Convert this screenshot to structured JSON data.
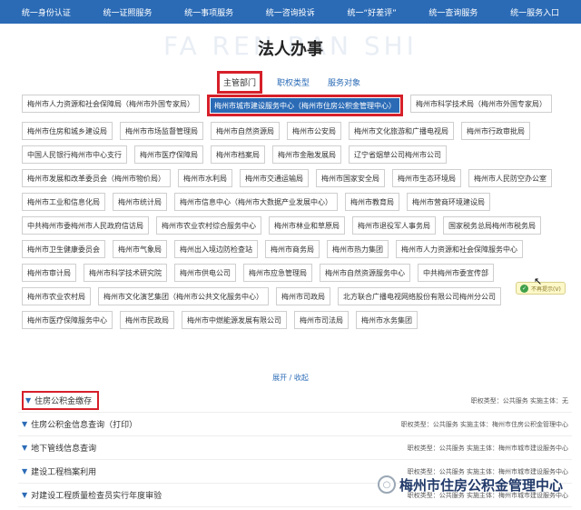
{
  "nav": {
    "items": [
      "统一身份认证",
      "统一证照服务",
      "统一事项服务",
      "统一咨询投诉",
      "统一“好差评”",
      "统一查询服务",
      "统一服务入口"
    ]
  },
  "hero": {
    "watermark": "FA REN BAN SHI",
    "title": "法人办事"
  },
  "tabs": {
    "items": [
      "主管部门",
      "职权类型",
      "服务对象"
    ],
    "active": 0
  },
  "departments": [
    "梅州市人力资源和社会保障局（梅州市外国专家局）",
    "梅州市城市建设服务中心（梅州市住房公积金管理中心）",
    "梅州市科学技术局（梅州市外国专家局）",
    "梅州市住房和城乡建设局",
    "梅州市市场监督管理局",
    "梅州市自然资源局",
    "梅州市公安局",
    "梅州市文化旅游和广播电视局",
    "梅州市行政审批局",
    "中国人民银行梅州市中心支行",
    "梅州市医疗保障局",
    "梅州市档案局",
    "梅州市金融发展局",
    "辽宁省烟草公司梅州市公司",
    "梅州市发展和改革委员会（梅州市物价局）",
    "梅州市水利局",
    "梅州市交通运输局",
    "梅州市国家安全局",
    "梅州市生态环境局",
    "梅州市人民防空办公室",
    "梅州市工业和信息化局",
    "梅州市统计局",
    "梅州市信息中心（梅州市大数据产业发展中心）",
    "梅州市教育局",
    "梅州市营商环境建设局",
    "中共梅州市委梅州市人民政府信访局",
    "梅州市农业农村综合服务中心",
    "梅州市林业和草原局",
    "梅州市退役军人事务局",
    "国家税务总局梅州市税务局",
    "梅州市卫生健康委员会",
    "梅州市气象局",
    "梅州出入境边防检查站",
    "梅州市商务局",
    "梅州市热力集团",
    "梅州市人力资源和社会保障服务中心",
    "梅州市审计局",
    "梅州市科学技术研究院",
    "梅州市供电公司",
    "梅州市应急管理局",
    "梅州市自然资源服务中心",
    "中共梅州市委宣传部",
    "梅州市农业农村局",
    "梅州市文化演艺集团（梅州市公共文化服务中心）",
    "梅州市司政局",
    "北方联合广播电视网络股份有限公司梅州分公司",
    "梅州市医疗保障服务中心",
    "梅州市民政局",
    "梅州市中燃能源发展有限公司",
    "梅州市司法局",
    "梅州市水务集团"
  ],
  "selected_department": 1,
  "expand_label": "展开 / 收起",
  "tooltip": {
    "check": "✓",
    "label": "不再提示(V)"
  },
  "services": [
    {
      "name": "住房公积金缴存",
      "meta": "职权类型：公共服务  实施主体：无"
    },
    {
      "name": "住房公积金信息查询（打印）",
      "meta": "职权类型：公共服务  实施主体：梅州市住房公积金管理中心"
    },
    {
      "name": "地下管线信息查询",
      "meta": "职权类型：公共服务  实施主体：梅州市城市建设服务中心"
    },
    {
      "name": "建设工程档案利用",
      "meta": "职权类型：公共服务  实施主体：梅州市城市建设服务中心"
    },
    {
      "name": "对建设工程质量检查员实行年度审验",
      "meta": "职权类型：公共服务  实施主体：梅州市城市建设服务中心"
    }
  ],
  "overlay_watermark": {
    "icon": "speech-bubble-icon",
    "text": "梅州市住房公积金管理中心"
  }
}
